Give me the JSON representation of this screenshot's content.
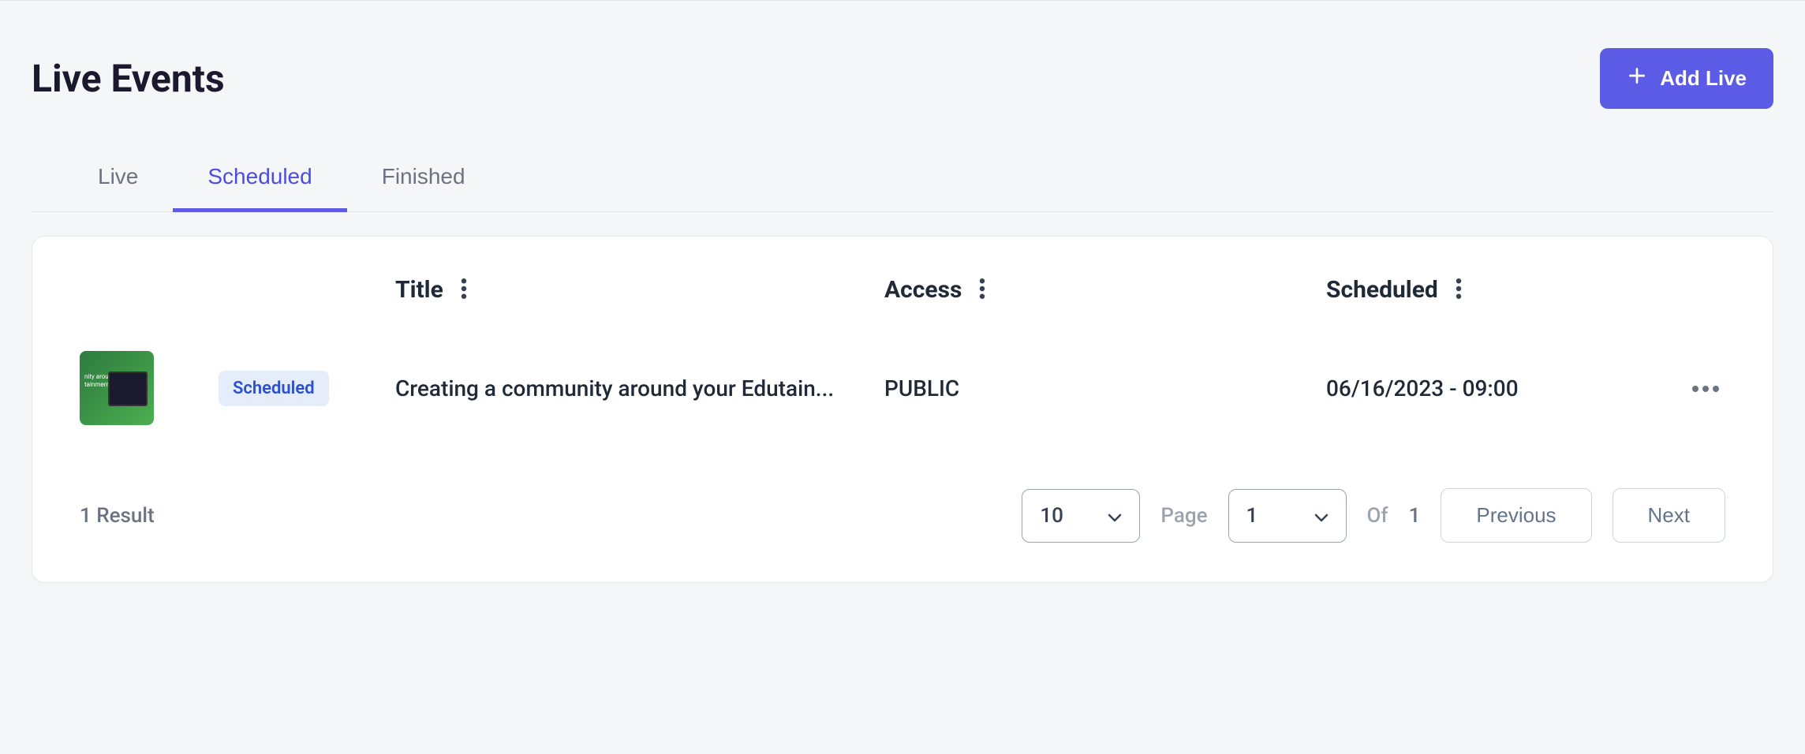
{
  "header": {
    "title": "Live Events",
    "add_button_label": "Add Live"
  },
  "tabs": {
    "live": "Live",
    "scheduled": "Scheduled",
    "finished": "Finished",
    "active": "scheduled"
  },
  "columns": {
    "title": "Title",
    "access": "Access",
    "scheduled": "Scheduled"
  },
  "rows": [
    {
      "status_badge": "Scheduled",
      "title": "Creating a community around your Edutain...",
      "access": "PUBLIC",
      "scheduled": "06/16/2023 - 09:00"
    }
  ],
  "footer": {
    "result_text": "1 Result",
    "page_size": "10",
    "page_label": "Page",
    "page_number": "1",
    "of_label": "Of",
    "total_pages": "1",
    "previous_label": "Previous",
    "next_label": "Next"
  }
}
